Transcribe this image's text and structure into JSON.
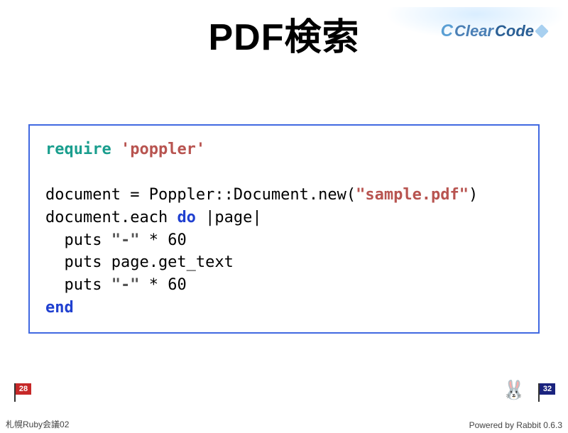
{
  "logo": {
    "c_glyph": "C",
    "text_clear": "Clear",
    "text_code": "Code"
  },
  "title": "PDF検索",
  "code": {
    "kw_require": "require",
    "lit_poppler": "'poppler'",
    "line_doc_new_pre": "document = Poppler::Document.new(",
    "lit_sample": "\"sample.pdf\"",
    "line_doc_new_post": ")",
    "line_each_pre": "document.each ",
    "kw_do": "do",
    "line_each_post": " |page|",
    "line_puts1_pre": "  puts ",
    "lit_dash1": "\"-\"",
    "line_puts1_post": " * 60",
    "line_puts2": "  puts page.get_text",
    "line_puts3_pre": "  puts ",
    "lit_dash2": "\"-\"",
    "line_puts3_post": " * 60",
    "kw_end": "end"
  },
  "footer": {
    "flag_left": "28",
    "flag_right": "32",
    "rabbit_glyph": "🐰",
    "left_text": "札幌Ruby会議02",
    "right_text": "Powered by Rabbit 0.6.3"
  }
}
